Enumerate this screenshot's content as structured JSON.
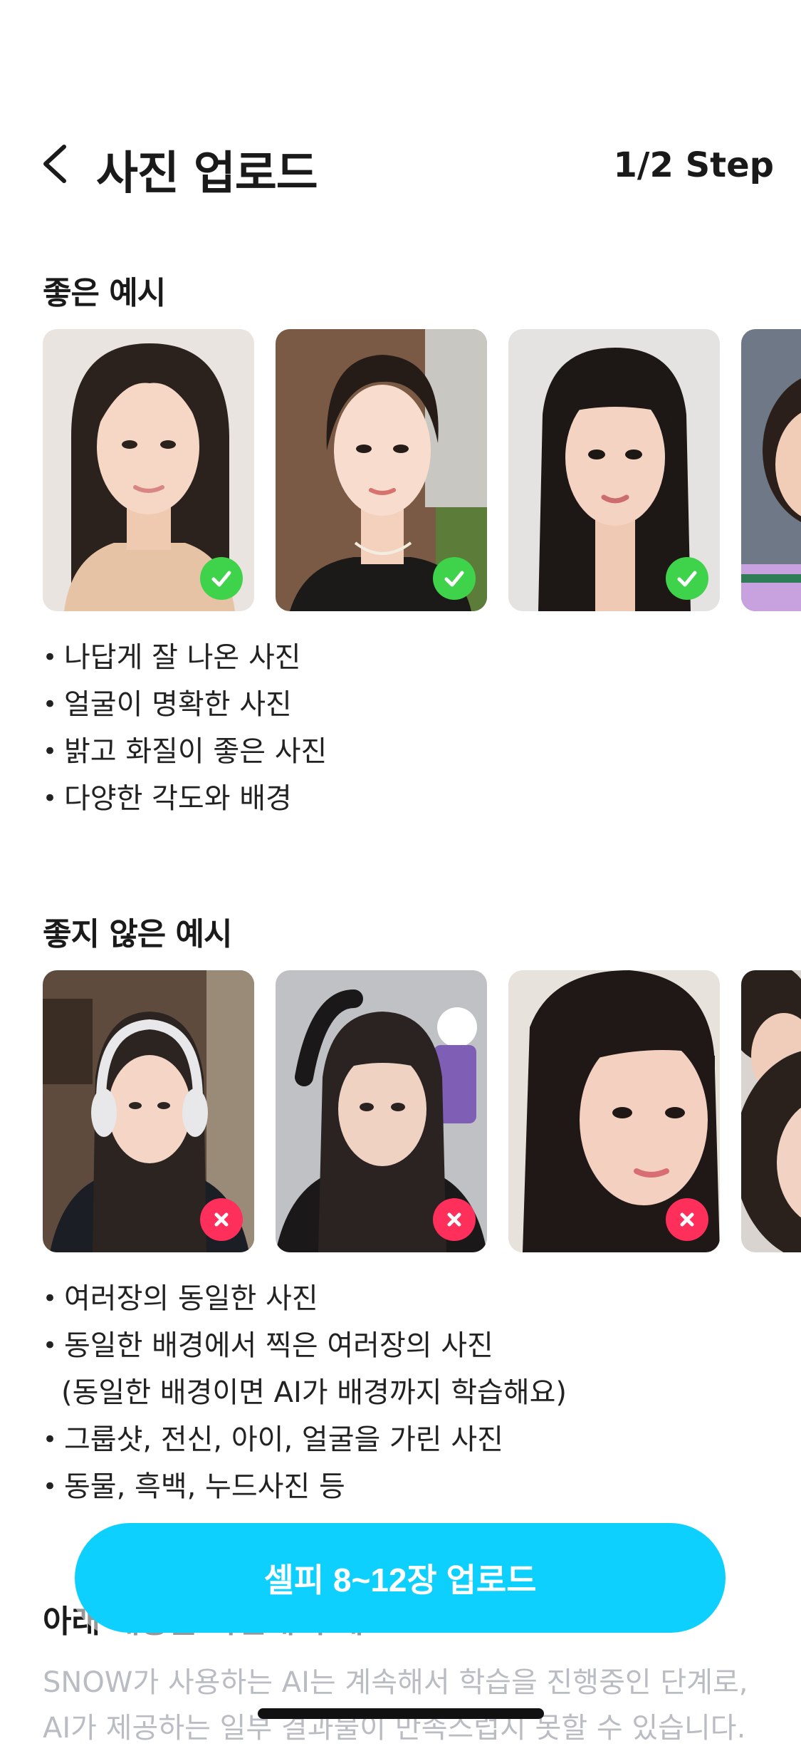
{
  "header": {
    "title": "사진 업로드",
    "step": "1/2 Step",
    "back_icon": "chevron-left-icon"
  },
  "good": {
    "title": "좋은 예시",
    "badge_icon": "check-circle-icon",
    "badge_color": "#3fd24b",
    "bullets": [
      "나답게 잘 나온 사진",
      "얼굴이 명확한 사진",
      "밝고 화질이 좋은 사진",
      "다양한 각도와 배경"
    ]
  },
  "bad": {
    "title": "좋지 않은 예시",
    "badge_icon": "x-circle-icon",
    "badge_color": "#ff2f5b",
    "bullets": [
      "여러장의 동일한 사진",
      "동일한 배경에서 찍은 여러장의 사진",
      "(동일한 배경이면 AI가 배경까지 학습해요)",
      "그룹샷, 전신, 아이, 얼굴을 가린 사진",
      "동물, 흑백, 누드사진 등"
    ]
  },
  "notice": {
    "title": "아래 내용을 확인해 주세요",
    "text": "SNOW가 사용하는 AI는 계속해서 학습을 진행중인 단계로, AI가 제공하는 일부 결과물이 만족스럽지 못할 수 있습니다."
  },
  "cta": {
    "label": "셀피 8~12장 업로드",
    "color": "#0ed0ff"
  }
}
